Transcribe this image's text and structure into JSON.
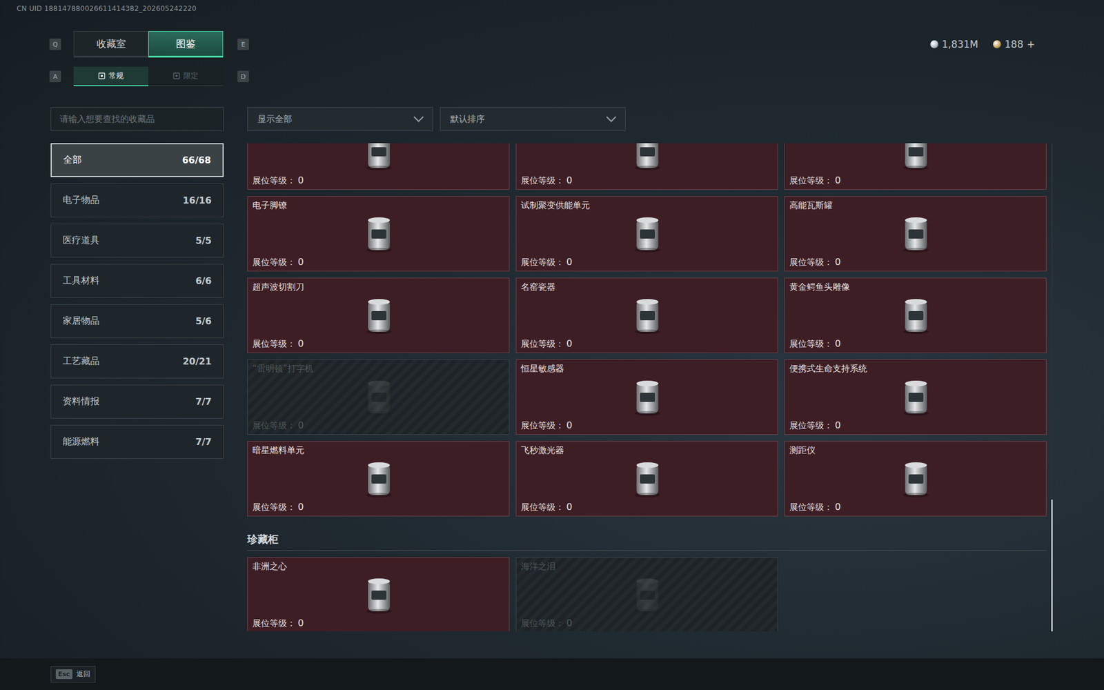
{
  "uid": "CN UID 188147880026611414382_202605242220",
  "tabs": {
    "prev_key": "Q",
    "next_key": "E",
    "items": [
      {
        "label": "收藏室",
        "selected": false
      },
      {
        "label": "图鉴",
        "selected": true
      }
    ]
  },
  "subtabs": {
    "prev_key": "A",
    "next_key": "D",
    "items": [
      {
        "label": "常规",
        "selected": true
      },
      {
        "label": "限定",
        "selected": false
      }
    ]
  },
  "currency": [
    {
      "value": "1,831M",
      "plus": "",
      "color": "#b9c0c5"
    },
    {
      "value": "188",
      "plus": "+",
      "color": "#c9a25a"
    }
  ],
  "search": {
    "placeholder": "请输入想要查找的收藏品"
  },
  "sidebar": {
    "items": [
      {
        "label": "全部",
        "count": "66/68",
        "selected": true
      },
      {
        "label": "电子物品",
        "count": "16/16",
        "selected": false
      },
      {
        "label": "医疗道具",
        "count": "5/5",
        "selected": false
      },
      {
        "label": "工具材料",
        "count": "6/6",
        "selected": false
      },
      {
        "label": "家居物品",
        "count": "5/6",
        "selected": false
      },
      {
        "label": "工艺藏品",
        "count": "20/21",
        "selected": false
      },
      {
        "label": "资料情报",
        "count": "7/7",
        "selected": false
      },
      {
        "label": "能源燃料",
        "count": "7/7",
        "selected": false
      }
    ]
  },
  "filters": [
    {
      "label": "显示全部"
    },
    {
      "label": "默认排序"
    }
  ],
  "level_label": "展位等级：",
  "grid": {
    "cards": [
      {
        "name": "",
        "level": "0",
        "collected": true
      },
      {
        "name": "",
        "level": "0",
        "collected": true
      },
      {
        "name": "",
        "level": "0",
        "collected": true
      },
      {
        "name": "电子脚镣",
        "level": "0",
        "collected": true
      },
      {
        "name": "试制聚变供能单元",
        "level": "0",
        "collected": true
      },
      {
        "name": "高能瓦斯罐",
        "level": "0",
        "collected": true
      },
      {
        "name": "超声波切割刀",
        "level": "0",
        "collected": true
      },
      {
        "name": "名窑瓷器",
        "level": "0",
        "collected": true
      },
      {
        "name": "黄金鳄鱼头雕像",
        "level": "0",
        "collected": true
      },
      {
        "name": "“雷明顿”打字机",
        "level": "0",
        "collected": false
      },
      {
        "name": "恒星敏感器",
        "level": "0",
        "collected": true
      },
      {
        "name": "便携式生命支持系统",
        "level": "0",
        "collected": true
      },
      {
        "name": "暗星燃料单元",
        "level": "0",
        "collected": true
      },
      {
        "name": "飞秒激光器",
        "level": "0",
        "collected": true
      },
      {
        "name": "测距仪",
        "level": "0",
        "collected": true
      }
    ]
  },
  "sections": [
    {
      "title": "珍藏柜",
      "cards": [
        {
          "name": "非洲之心",
          "level": "0",
          "collected": true
        },
        {
          "name": "海洋之泪",
          "level": "0",
          "collected": false
        }
      ]
    }
  ],
  "scrollbar": {
    "thumb_start": 0.73,
    "thumb_size": 0.27
  },
  "footer": {
    "key": "Esc",
    "label": "返回"
  }
}
